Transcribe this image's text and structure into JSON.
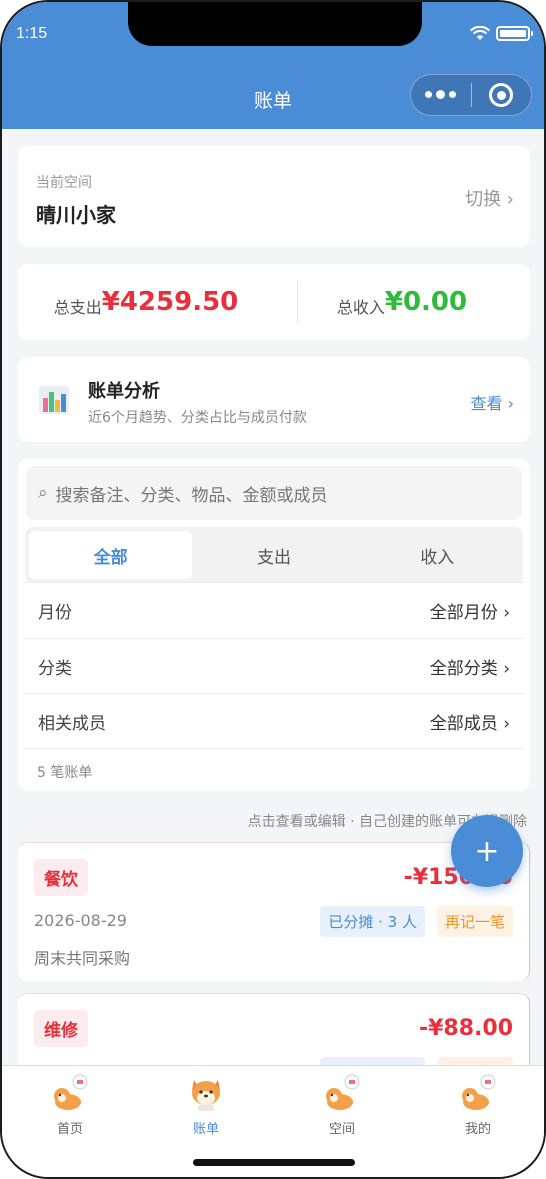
{
  "status": {
    "time": "1:15"
  },
  "nav": {
    "title": "账单"
  },
  "space": {
    "label": "当前空间",
    "name": "晴川小家",
    "switch_label": "切换 ›"
  },
  "totals": {
    "expense_label": "总支出",
    "expense_value": "¥4259.50",
    "income_label": "总收入",
    "income_value": "¥0.00"
  },
  "analysis": {
    "title": "账单分析",
    "subtitle": "近6个月趋势、分类占比与成员付款",
    "view_label": "查看 ›"
  },
  "filter": {
    "search_placeholder": "搜索备注、分类、物品、金额或成员",
    "tabs": [
      {
        "label": "全部",
        "active": true
      },
      {
        "label": "支出",
        "active": false
      },
      {
        "label": "收入",
        "active": false
      }
    ],
    "rows": [
      {
        "key": "月份",
        "value": "全部月份 ›"
      },
      {
        "key": "分类",
        "value": "全部分类 ›"
      },
      {
        "key": "相关成员",
        "value": "全部成员 ›"
      }
    ],
    "count_text": "5 笔账单"
  },
  "hint": "点击查看或编辑 · 自己创建的账单可左滑删除",
  "bills": [
    {
      "category": "餐饮",
      "amount": "-¥150.00",
      "date": "2026-08-29",
      "split": "已分摊 · 3 人",
      "again": "再记一笔",
      "note": "周末共同采购"
    },
    {
      "category": "维修",
      "amount": "-¥88.00"
    }
  ],
  "fab": {
    "label": "+"
  },
  "tabbar": {
    "items": [
      {
        "label": "首页",
        "icon": "shiba-idle-icon",
        "active": false
      },
      {
        "label": "账单",
        "icon": "shiba-face-icon",
        "active": true
      },
      {
        "label": "空间",
        "icon": "shiba-idle-icon",
        "active": false
      },
      {
        "label": "我的",
        "icon": "shiba-idle-icon",
        "active": false
      }
    ]
  },
  "colors": {
    "brand": "#4a8cd6",
    "expense": "#e8303c",
    "income": "#2fba3a"
  }
}
